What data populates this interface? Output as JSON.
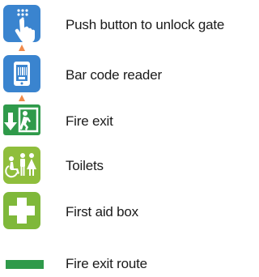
{
  "legend": {
    "items": [
      {
        "label": "Push button to unlock gate",
        "icon": "push-button-icon",
        "color": "#3a84cf"
      },
      {
        "label": "Bar code reader",
        "icon": "barcode-reader-icon",
        "color": "#3a84cf"
      },
      {
        "label": "Fire exit",
        "icon": "fire-exit-icon",
        "color": "#2f9a4a"
      },
      {
        "label": "Toilets",
        "icon": "toilets-icon",
        "color": "#8fbe3c"
      },
      {
        "label": "First aid box",
        "icon": "first-aid-icon",
        "color": "#7fb83a"
      },
      {
        "label": "Fire exit route",
        "icon": "fire-exit-route-line",
        "color": "#2f9a4a"
      }
    ],
    "connector_color": "#f08a4b"
  }
}
